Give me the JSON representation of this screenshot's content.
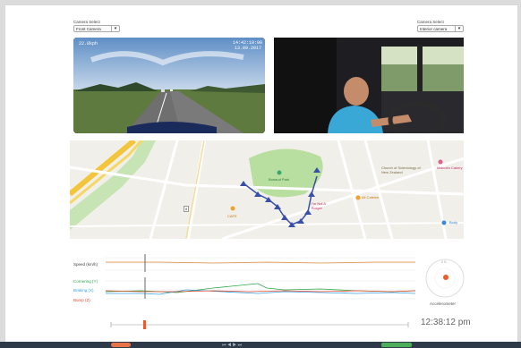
{
  "camera_left": {
    "label": "Camera Select",
    "value": "Front Camera"
  },
  "camera_right": {
    "label": "Camera Select",
    "value": "Interior camera"
  },
  "front_video": {
    "hud_left": "22.8kph",
    "hud_time": "14:42:19:00",
    "hud_date": "13.09.2017"
  },
  "map": {
    "park": "Bonaud Park",
    "poi_church": "Church of Scientology of New Zealand",
    "poi_cafe": "All Cafeine",
    "poi_right": "Malcolm Cakery",
    "poi_left": "CAFE",
    "poi_mid": "I'm Not A Burger",
    "poi_body": "Body",
    "route_no": "8"
  },
  "charts": {
    "speed_label": "Speed (km/h)",
    "cornering_label": "Cornering (Y)",
    "braking_label": "Braking (X)",
    "bump_label": "Bump (Z)",
    "accelerometer_label": "Accelerometer",
    "dial_top": "0 G"
  },
  "timeline": {
    "time": "12:38:12 pm"
  },
  "colors": {
    "speed": "#e08a3a",
    "cornering": "#2ea84a",
    "braking": "#3aa0e0",
    "bump": "#e04a30",
    "route": "#3a4fa8",
    "footer": "#2e3a48"
  }
}
